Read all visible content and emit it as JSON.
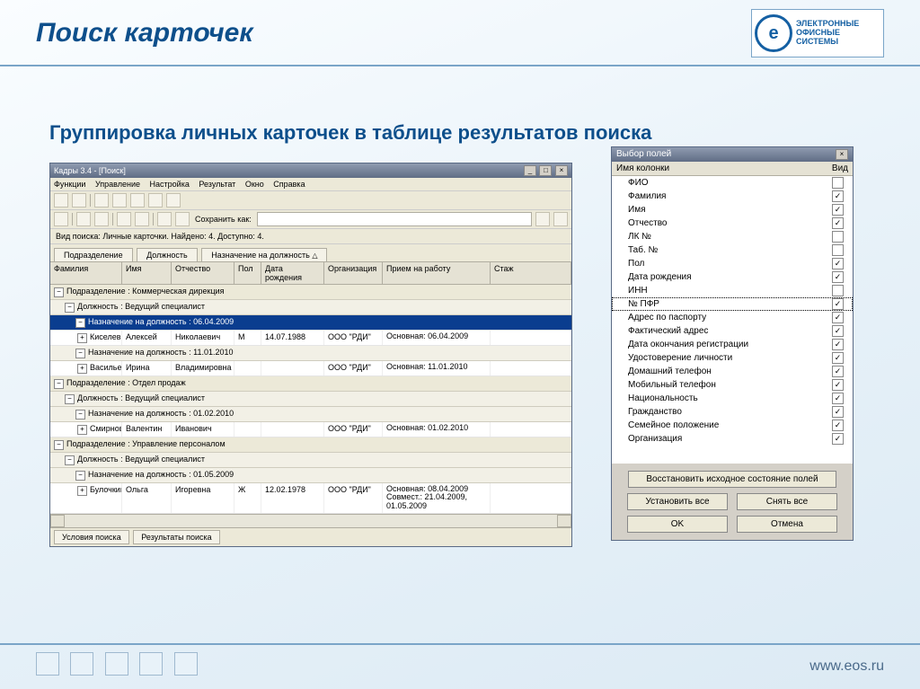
{
  "slide": {
    "title": "Поиск карточек",
    "subtitle": "Группировка личных карточек в таблице результатов поиска",
    "footer_url": "www.eos.ru",
    "logo_lines": [
      "ЭЛЕКТРОННЫЕ",
      "ОФИСНЫЕ",
      "СИСТЕМЫ"
    ]
  },
  "app": {
    "title": "Кадры 3.4 - [Поиск]",
    "menu": [
      "Функции",
      "Управление",
      "Настройка",
      "Результат",
      "Окно",
      "Справка"
    ],
    "save_as_label": "Сохранить как:",
    "infobar": "Вид поиска: Личные карточки. Найдено: 4. Доступно: 4.",
    "tabs_top": [
      "Подразделение",
      "Должность",
      "Назначение на должность"
    ],
    "columns": [
      "Фамилия",
      "Имя",
      "Отчество",
      "Пол",
      "Дата рождения",
      "Организация",
      "Прием на работу",
      "Стаж"
    ],
    "groups": [
      {
        "level": 0,
        "label": "Подразделение : Коммерческая дирекция"
      },
      {
        "level": 1,
        "label": "Должность : Ведущий специалист"
      },
      {
        "level": 2,
        "label": "Назначение на должность : 06.04.2009",
        "selected": true
      },
      {
        "row": {
          "fam": "Киселев",
          "name": "Алексей",
          "otch": "Николаевич",
          "pol": "М",
          "dr": "14.07.1988",
          "org": "ООО \"РДИ\"",
          "hire": "Основная: 06.04.2009"
        }
      },
      {
        "level": 2,
        "label": "Назначение на должность : 11.01.2010"
      },
      {
        "row": {
          "fam": "Васильева",
          "name": "Ирина",
          "otch": "Владимировна",
          "pol": "",
          "dr": "",
          "org": "ООО \"РДИ\"",
          "hire": "Основная: 11.01.2010"
        }
      },
      {
        "level": 0,
        "label": "Подразделение : Отдел продаж"
      },
      {
        "level": 1,
        "label": "Должность : Ведущий специалист"
      },
      {
        "level": 2,
        "label": "Назначение на должность : 01.02.2010"
      },
      {
        "row": {
          "fam": "Смирнов",
          "name": "Валентин",
          "otch": "Иванович",
          "pol": "",
          "dr": "",
          "org": "ООО \"РДИ\"",
          "hire": "Основная: 01.02.2010"
        }
      },
      {
        "level": 0,
        "label": "Подразделение : Управление персоналом"
      },
      {
        "level": 1,
        "label": "Должность : Ведущий специалист"
      },
      {
        "level": 2,
        "label": "Назначение на должность : 01.05.2009"
      },
      {
        "row": {
          "fam": "Булочкина",
          "name": "Ольга",
          "otch": "Игоревна",
          "pol": "Ж",
          "dr": "12.02.1978",
          "org": "ООО \"РДИ\"",
          "hire": "Основная: 08.04.2009 Совмест.: 21.04.2009, 01.05.2009"
        }
      }
    ],
    "tabs_bottom": [
      "Условия поиска",
      "Результаты поиска"
    ]
  },
  "dialog": {
    "title": "Выбор полей",
    "head_name": "Имя колонки",
    "head_vid": "Вид",
    "fields": [
      {
        "name": "ФИО",
        "checked": false
      },
      {
        "name": "Фамилия",
        "checked": true
      },
      {
        "name": "Имя",
        "checked": true
      },
      {
        "name": "Отчество",
        "checked": true
      },
      {
        "name": "ЛК №",
        "checked": false
      },
      {
        "name": "Таб. №",
        "checked": false
      },
      {
        "name": "Пол",
        "checked": true
      },
      {
        "name": "Дата рождения",
        "checked": true
      },
      {
        "name": "ИНН",
        "checked": false
      },
      {
        "name": "№ ПФР",
        "checked": true,
        "selected": true
      },
      {
        "name": "Адрес по паспорту",
        "checked": true
      },
      {
        "name": "Фактический адрес",
        "checked": true
      },
      {
        "name": "Дата окончания регистрации",
        "checked": true
      },
      {
        "name": "Удостоверение личности",
        "checked": true
      },
      {
        "name": "Домашний телефон",
        "checked": true
      },
      {
        "name": "Мобильный телефон",
        "checked": true
      },
      {
        "name": "Национальность",
        "checked": true
      },
      {
        "name": "Гражданство",
        "checked": true
      },
      {
        "name": "Семейное положение",
        "checked": true
      },
      {
        "name": "Организация",
        "checked": true
      }
    ],
    "btn_restore": "Восстановить исходное состояние полей",
    "btn_set_all": "Установить все",
    "btn_clear_all": "Снять все",
    "btn_ok": "OK",
    "btn_cancel": "Отмена"
  }
}
